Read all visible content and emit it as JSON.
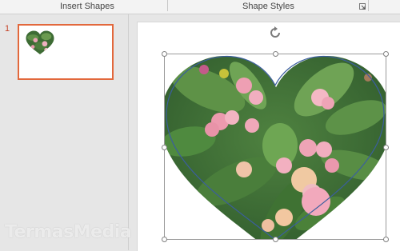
{
  "ribbon": {
    "groups": [
      {
        "label": "Insert Shapes"
      },
      {
        "label": "Shape Styles"
      }
    ],
    "launcher_icon": "dialog-launcher-icon"
  },
  "thumbnails": {
    "slide_number": "1",
    "selected_color": "#e2683c"
  },
  "slide": {
    "shape": "heart",
    "fill": "photo of pink crown-of-thorns flowers with green leaves",
    "outline_color": "#3b5e9e",
    "selected": true
  },
  "watermark": {
    "text": "TermasMedia"
  }
}
